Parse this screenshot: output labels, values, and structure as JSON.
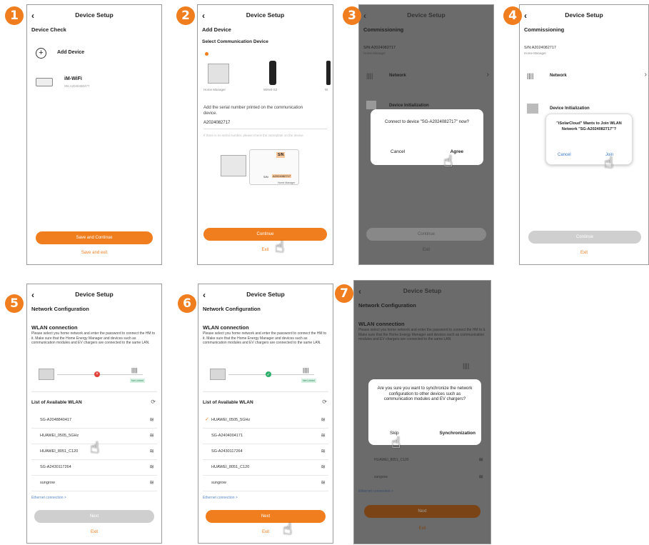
{
  "steps": [
    "1",
    "2",
    "3",
    "4",
    "5",
    "6",
    "7"
  ],
  "icons": {
    "back": "chevron-left-icon",
    "hand": "pointing-hand-icon",
    "wifi": "wifi-icon",
    "refresh": "refresh-icon",
    "check": "check-icon",
    "plus": "plus-circle-icon",
    "chevron": "chevron-right-icon"
  },
  "colors": {
    "accent": "#f07d1e",
    "dark_bg": "#6b6b6b",
    "error": "#e0403a",
    "success": "#2fae6b"
  },
  "p1": {
    "title": "Device Setup",
    "section": "Device Check",
    "add_device": "Add Device",
    "device_name": "iM-WiFi",
    "device_sn": "SN:A2040490477",
    "primary": "Save and Continue",
    "secondary": "Save and exit"
  },
  "p2": {
    "title": "Device Setup",
    "section": "Add Device",
    "subsection": "Select Communication Device",
    "dev1": "Home Manager",
    "dev2": "WiNet-S2",
    "dev3": "W",
    "instruction": "Add the serial number printed on the communication device.",
    "serial_value": "A2024082717",
    "hint": "If there is no serial number, please check the nameplate on the device.",
    "label_sn": "S/N",
    "label_sn_small": "S/N",
    "label_code": "A2024082717",
    "label_brand": "Home Manager",
    "primary": "Continue",
    "secondary": "Exit"
  },
  "p3": {
    "title": "Device Setup",
    "section": "Commissioning",
    "sn": "S/N:A2024082717",
    "sn_sub": "Home Manager",
    "network": "Network",
    "init": "Device Initialization",
    "dialog_text": "Connect to device \"SG-A2024082717\" now?",
    "cancel": "Cancel",
    "agree": "Agree",
    "primary": "Continue",
    "secondary": "Exit"
  },
  "p4": {
    "title": "Device Setup",
    "section": "Commissioning",
    "sn": "S/N:A2024082717",
    "sn_sub": "Home Manager",
    "network": "Network",
    "init": "Device Initialization",
    "dialog_text": "\"iSolarCloud\" Wants to Join WLAN Network \"SG-A2024082717\"?",
    "cancel": "Cancel",
    "join": "Join",
    "primary": "Continue",
    "secondary": "Exit"
  },
  "p5": {
    "title": "Device Setup",
    "section": "Network Configuration",
    "wlan_title": "WLAN connection",
    "desc": "Please select you home network and enter the password to connect the HM to it. Make sure that the Home Energy Manager and devices such as communication modules and EV chargers are connected to the same LAN.",
    "list_title": "List of Available WLAN",
    "networks": [
      "SG-A2048840417",
      "HUAWEI_0505_5GHz",
      "HUAWEI_8051_C120",
      "SG-A2430117264",
      "sungrow"
    ],
    "ethernet": "Ethernet connection >",
    "badge": "Not Linked",
    "primary": "Next",
    "secondary": "Exit"
  },
  "p6": {
    "title": "Device Setup",
    "section": "Network Configuration",
    "wlan_title": "WLAN connection",
    "desc": "Please select you home network and enter the password to connect the HM to it. Make sure that the Home Energy Manager and devices such as communication modules and EV chargers are connected to the same LAN.",
    "list_title": "List of Available WLAN",
    "networks": [
      "HUAWEI_0505_5GHz",
      "SG-A2404004171",
      "SG-A2430117264",
      "HUAWEI_8051_C120",
      "sungrow"
    ],
    "ethernet": "Ethernet connection >",
    "badge": "Net Linked",
    "primary": "Next",
    "secondary": "Exit"
  },
  "p7": {
    "title": "Device Setup",
    "section": "Network Configuration",
    "wlan_title": "WLAN connection",
    "desc": "Please select you home network and enter the password to connect the HM to it. Make sure that the Home Energy Manager and devices such as communication modules and EV chargers are connected to the same LAN.",
    "dialog_text": "Are you sure you want to synchronize the network configuration to other devices such as communication modules and EV chargers?",
    "skip": "Skip",
    "sync": "Synchronization",
    "row1": "HUAWEI_8051_C120",
    "row2": "sungrow",
    "ethernet": "Ethernet connection >",
    "primary": "Next",
    "secondary": "Exit"
  }
}
